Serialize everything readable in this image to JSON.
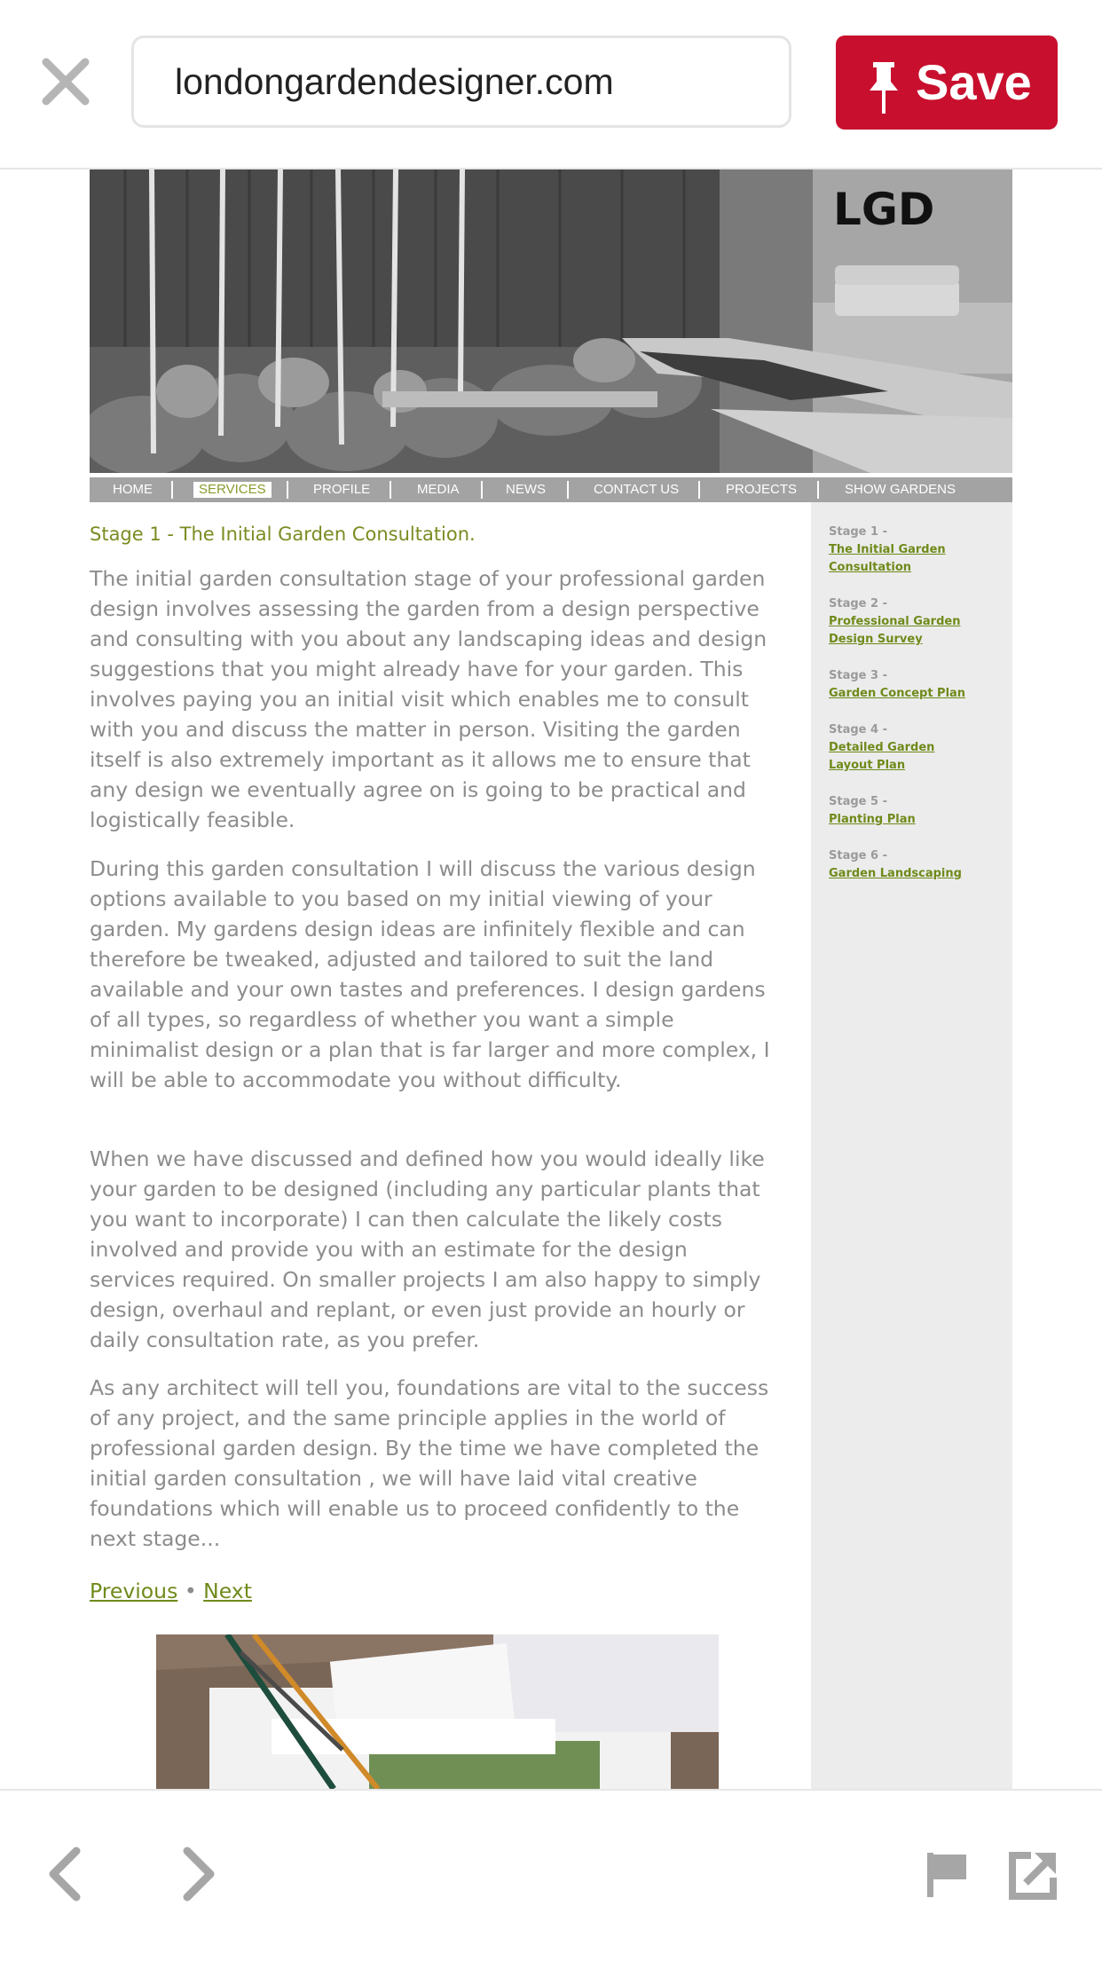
{
  "topbar": {
    "url": "londongardendesigner.com",
    "save_label": "Save"
  },
  "site": {
    "logo_text": "LGD",
    "nav": [
      "HOME",
      "SERVICES",
      "PROFILE",
      "MEDIA",
      "NEWS",
      "CONTACT US",
      "PROJECTS",
      "SHOW GARDENS"
    ],
    "nav_active": "SERVICES",
    "heading": "Stage 1 - The Initial Garden Consultation.",
    "paragraphs": [
      "The initial garden consultation stage of your professional garden design involves assessing the garden from a design perspective and consulting with you about any landscaping ideas and design suggestions that you might already have for your garden. This involves paying you an initial visit which enables me to consult with you and discuss the matter in person. Visiting the garden itself is also extremely important as it allows me to ensure that any design we eventually agree on is going to be practical and logistically feasible.",
      "During this garden consultation I will discuss the various design options available to you based on my initial viewing of your garden. My gardens design ideas are infinitely flexible and can therefore be tweaked, adjusted and tailored to suit the land available and your own tastes and preferences. I design gardens of all types, so regardless of whether you want a simple minimalist design or a plan that is far larger and more complex, I will be able to accommodate you without difficulty.",
      "When we have discussed and defined how you would ideally like your garden to be designed (including any particular plants that you want to incorporate) I can then calculate the likely costs involved and provide you with an estimate for the design services required. On smaller projects I am also happy to simply design, overhaul and replant, or even just provide an hourly or daily consultation rate, as you prefer.",
      "As any architect will tell you, foundations are vital to the success of any project, and the same principle applies in the world of professional garden design. By the time we have completed the initial garden consultation , we will have laid vital creative foundations which will enable us to proceed confidently to the next stage..."
    ],
    "pager": {
      "previous": "Previous",
      "separator": "•",
      "next": "Next"
    },
    "stages": [
      {
        "num": "Stage 1 -",
        "title": "The Initial Garden Consultation"
      },
      {
        "num": "Stage 2 -",
        "title": "Professional Garden Design Survey"
      },
      {
        "num": "Stage 3 -",
        "title": "Garden Concept Plan"
      },
      {
        "num": "Stage 4 -",
        "title": "Detailed Garden Layout Plan"
      },
      {
        "num": "Stage 5 -",
        "title": "Planting Plan"
      },
      {
        "num": "Stage 6 -",
        "title": "Garden Landscaping"
      }
    ]
  },
  "bottombar": {
    "icons": [
      "back-arrow-icon",
      "forward-arrow-icon",
      "flag-icon",
      "share-external-icon"
    ]
  },
  "colors": {
    "pinterest_red": "#c8102e",
    "site_green": "#7a8c21",
    "body_text": "#8c8c8c",
    "nav_grey": "#a3a3a3",
    "sidebar_bg": "#ececec"
  }
}
